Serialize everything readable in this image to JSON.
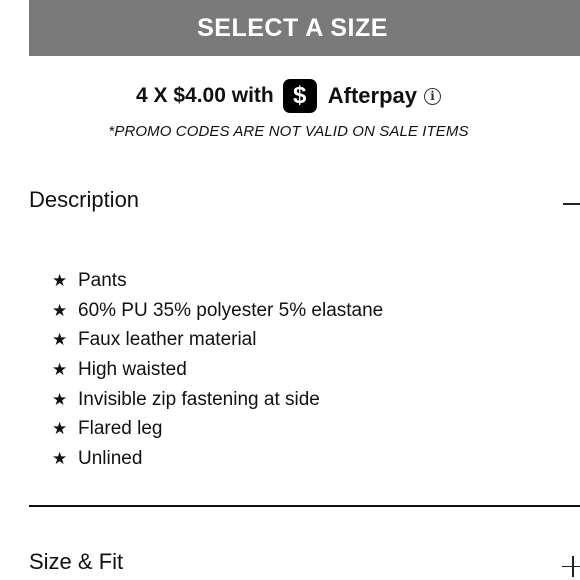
{
  "select_size": {
    "label": "SELECT A SIZE",
    "bg_color": "#7a7a7a"
  },
  "afterpay": {
    "text": "4 X $4.00 with",
    "logo_symbol": "$",
    "brand": "Afterpay",
    "logo_icon": "cash-app-icon",
    "info_icon": "info-icon",
    "info_symbol": "i"
  },
  "promo_note": "*PROMO CODES ARE NOT VALID ON SALE ITEMS",
  "description": {
    "title": "Description",
    "expanded": true,
    "toggle_icon": "minus-icon",
    "bullet_icon": "star-icon",
    "bullet_symbol": "★",
    "items": [
      "Pants",
      "60% PU 35% polyester 5% elastane",
      "Faux leather material",
      "High waisted",
      "Invisible zip fastening at side",
      "Flared leg",
      "Unlined"
    ]
  },
  "size_fit": {
    "title": "Size & Fit",
    "expanded": false,
    "toggle_icon": "plus-icon"
  }
}
